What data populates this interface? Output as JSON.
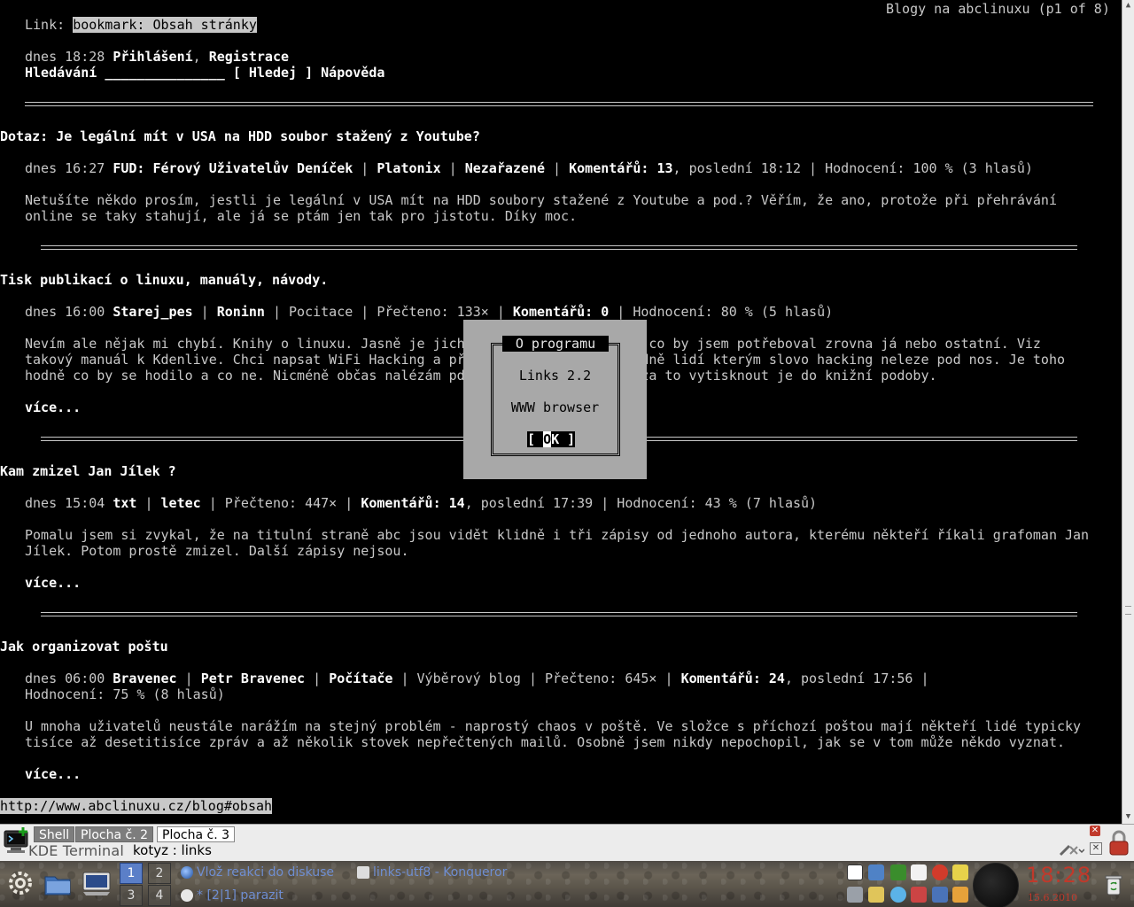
{
  "screen_title": "Blogy na abclinuxu (p1 of 8)",
  "link_line": {
    "label": "Link:",
    "value": "bookmark: Obsah stránky"
  },
  "login_line": {
    "time": "dnes 18:28",
    "login": "Přihlášení",
    "sep": ", ",
    "register": "Registrace"
  },
  "search_line": {
    "label": "Hledávání",
    "field": "_______________",
    "button": "[ Hledej ]",
    "help": "Nápověda"
  },
  "posts": [
    {
      "title": "Dotaz: Je legální mít v USA na HDD soubor stažený z Youtube?",
      "meta": {
        "time": "dnes 16:27",
        "blog": "FUD: Férový Uživatelův Deníček",
        "author": "Platonix",
        "category": "Nezařazené",
        "comments": "Komentářů: 13",
        "rest": ", poslední 18:12 | Hodnocení: 100 % (3 hlasů)"
      },
      "body": [
        "Netušíte někdo prosím, jestli je legální v USA mít na HDD soubory stažené z Youtube a pod.? Věřím, že ano, protože při přehrávání",
        "online se taky stahují, ale já se ptám jen tak pro jistotu. Díky moc."
      ]
    },
    {
      "title": "Tisk publikací o linuxu, manuály, návody.",
      "meta": {
        "time": "dnes 16:00",
        "blog": "Starej_pes",
        "author": "Roninn",
        "category": "Pocitace",
        "read": "Přečteno: 133×",
        "comments": "Komentářů: 0",
        "rest": " | Hodnocení: 80 % (5 hlasů)"
      },
      "body": [
        "Nevím ale nějak mi chybí. Knihy o linuxu. Jasně je jich                    to co by jsem potřeboval zrovna já nebo ostatní. Viz",
        "takový manuál k Kdenlive. Chci napsat WiFi Hacking a př                    hodně lidí kterým slovo hacking neleze pod nos. Je toho",
        "hodně co by se hodilo a co ne. Nicméně občas nalézám pd                    y za to vytisknout je do knižní podoby."
      ],
      "more": "více..."
    },
    {
      "title": "Kam zmizel Jan Jílek ?",
      "meta": {
        "time": "dnes 15:04",
        "blog": "txt",
        "author": "letec",
        "read": "Přečteno: 447×",
        "comments": "Komentářů: 14",
        "rest": ", poslední 17:39 | Hodnocení: 43 % (7 hlasů)"
      },
      "body": [
        "Pomalu jsem si zvykal, že na titulní straně abc jsou vidět klidně i tři zápisy od jednoho autora, kterému někteří říkali grafoman Jan",
        "Jílek. Potom prostě zmizel. Další zápisy nejsou."
      ],
      "more": "více..."
    },
    {
      "title": "Jak organizovat poštu",
      "meta": {
        "time": "dnes 06:00",
        "blog": "Bravenec",
        "author": "Petr Bravenec",
        "category": "Počítače",
        "extra": "Výběrový blog",
        "read": "Přečteno: 645×",
        "comments": "Komentářů: 24",
        "rest": ", poslední 17:56 |",
        "rest2": "Hodnocení: 75 % (8 hlasů)"
      },
      "body": [
        "U mnoha uživatelů neustále narážím na stejný problém - naprostý chaos v poště. Ve složce s příchozí poštou mají někteří lidé typicky",
        "tisíce až desetitisíce zpráv a až několik stovek nepřečtených mailů. Osobně jsem nikdy nepochopil, jak se v tom může někdo vyznat."
      ],
      "more": "více..."
    }
  ],
  "status_url": "http://www.abclinuxu.cz/blog#obsah",
  "dialog": {
    "title": "O programu",
    "line1": "Links 2.2",
    "line2": "WWW browser",
    "ok_left": "[ ",
    "ok_cursor": "O",
    "ok_right": "K ]"
  },
  "konsole": {
    "tabs": [
      "Shell",
      "Plocha č. 2",
      "Plocha č. 3"
    ],
    "active_tab": 2,
    "app_name": "KDE Terminal",
    "window_title": "kotyz : links"
  },
  "panel": {
    "desktops": [
      "1",
      "2",
      "3",
      "4"
    ],
    "active_desktop": 0,
    "tasks": [
      "Vlož reakci do diskuse",
      "links-utf8 - Konqueror",
      "* [2|1] parazit"
    ],
    "clock": "18:28",
    "date": "15.6.2010"
  },
  "colors": {
    "terminal_bg": "#000000",
    "terminal_fg": "#c8c8c8",
    "dialog_bg": "#a8a8a8",
    "clock": "#c0392b",
    "task_link": "#6f8ed1"
  }
}
